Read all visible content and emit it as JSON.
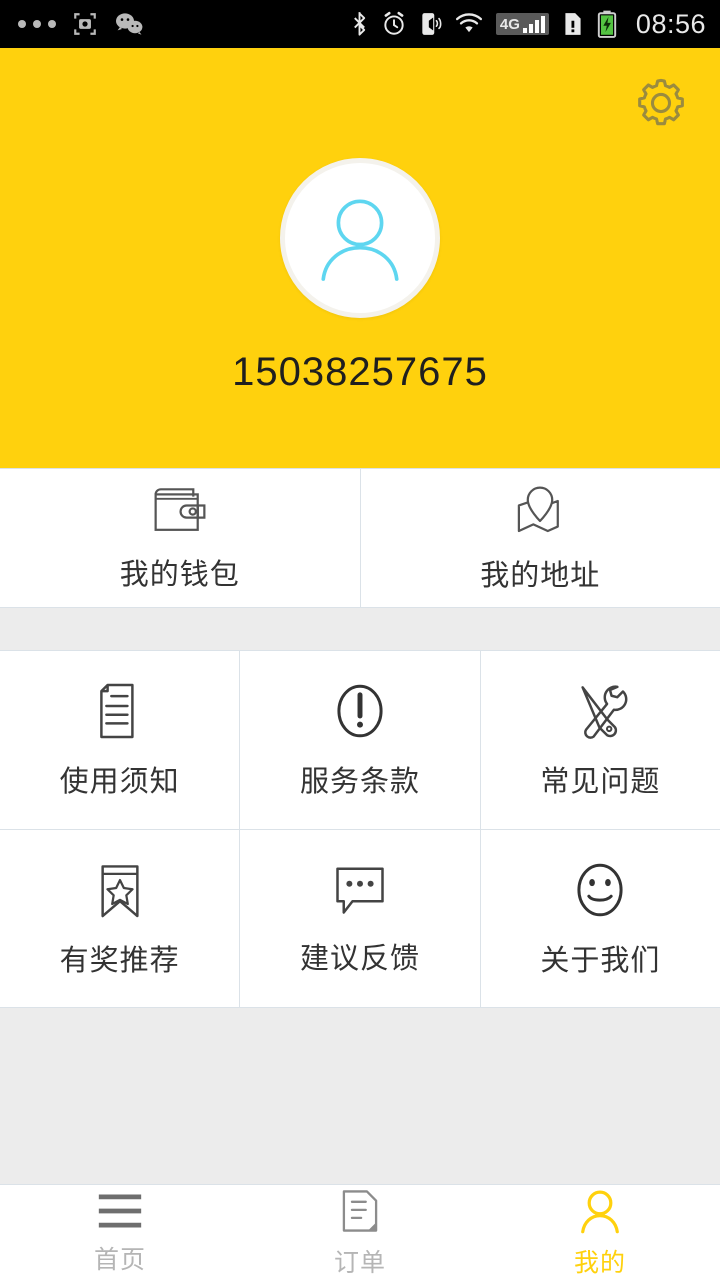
{
  "statusbar": {
    "time": "08:56",
    "network_label": "4G",
    "left_icons": [
      "more-dots-icon",
      "screenshot-camera-icon",
      "wechat-icon"
    ],
    "right_icons": [
      "bluetooth-icon",
      "alarm-clock-icon",
      "vibrate-icon",
      "wifi-icon",
      "signal-bars-icon",
      "sim-card-icon",
      "battery-charging-icon"
    ]
  },
  "header": {
    "settings_icon": "gear-icon",
    "avatar_icon": "person-avatar-icon",
    "phone": "15038257675",
    "bg_color": "#FFD10D"
  },
  "quick_row": [
    {
      "label": "我的钱包",
      "icon": "wallet-icon",
      "name": "my-wallet"
    },
    {
      "label": "我的地址",
      "icon": "map-pin-icon",
      "name": "my-address"
    }
  ],
  "menu_grid": [
    [
      {
        "label": "使用须知",
        "icon": "document-lines-icon",
        "name": "usage-notice"
      },
      {
        "label": "服务条款",
        "icon": "exclamation-circle-icon",
        "name": "service-terms"
      },
      {
        "label": "常见问题",
        "icon": "wrench-screwdriver-icon",
        "name": "faq"
      }
    ],
    [
      {
        "label": "有奖推荐",
        "icon": "bookmark-star-icon",
        "name": "referral-reward"
      },
      {
        "label": "建议反馈",
        "icon": "speech-bubble-icon",
        "name": "feedback"
      },
      {
        "label": "关于我们",
        "icon": "smiley-face-icon",
        "name": "about-us"
      }
    ]
  ],
  "tabbar": {
    "active_color": "#FFD10D",
    "inactive_color": "#B5B5B5",
    "items": [
      {
        "label": "首页",
        "icon": "hamburger-menu-icon",
        "name": "home",
        "active": false
      },
      {
        "label": "订单",
        "icon": "order-document-icon",
        "name": "orders",
        "active": false
      },
      {
        "label": "我的",
        "icon": "person-icon",
        "name": "profile",
        "active": true
      }
    ]
  }
}
